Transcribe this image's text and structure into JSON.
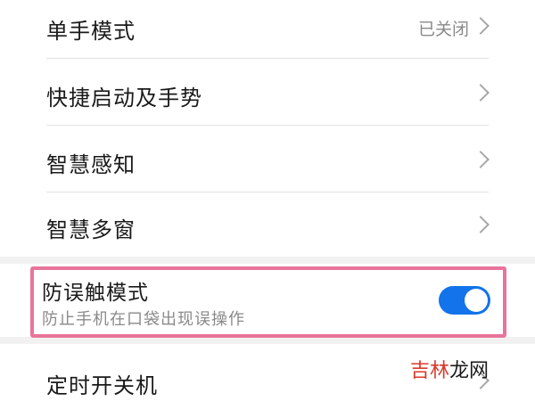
{
  "settings": {
    "items": [
      {
        "title": "单手模式",
        "value": "已关闭"
      },
      {
        "title": "快捷启动及手势"
      },
      {
        "title": "智慧感知"
      },
      {
        "title": "智慧多窗"
      }
    ],
    "mistouch": {
      "title": "防误触模式",
      "description": "防止手机在口袋出现误操作",
      "enabled": true
    },
    "last_item": {
      "title": "定时开关机"
    }
  },
  "watermark": {
    "part1": "吉林",
    "part2": "龙网",
    "color1": "#d93a2b",
    "color2": "#1a1a1a"
  },
  "colors": {
    "accent": "#1273ea",
    "highlight_border": "#e9749a",
    "secondary_text": "#8a8a8a"
  }
}
